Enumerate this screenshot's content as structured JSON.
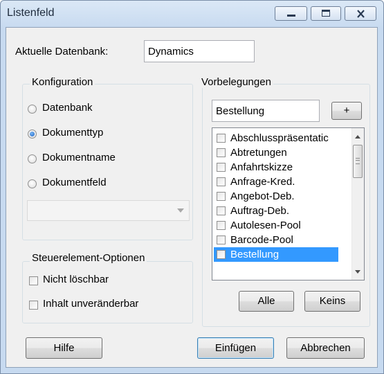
{
  "window": {
    "title": "Listenfeld"
  },
  "database": {
    "label": "Aktuelle Datenbank:",
    "value": "Dynamics"
  },
  "config": {
    "title": "Konfiguration",
    "options": [
      {
        "label": "Datenbank",
        "selected": false
      },
      {
        "label": "Dokumenttyp",
        "selected": true
      },
      {
        "label": "Dokumentname",
        "selected": false
      },
      {
        "label": "Dokumentfeld",
        "selected": false
      }
    ],
    "combo_value": ""
  },
  "control_options": {
    "title": "Steuerelement-Optionen",
    "items": [
      {
        "label": "Nicht löschbar",
        "checked": false
      },
      {
        "label": "Inhalt unveränderbar",
        "checked": false
      }
    ]
  },
  "presets": {
    "title": "Vorbelegungen",
    "input_value": "Bestellung",
    "add_label": "+",
    "items": [
      {
        "label": "Abschlusspräsentatic",
        "checked": false,
        "selected": false
      },
      {
        "label": "Abtretungen",
        "checked": false,
        "selected": false
      },
      {
        "label": "Anfahrtskizze",
        "checked": false,
        "selected": false
      },
      {
        "label": "Anfrage-Kred.",
        "checked": false,
        "selected": false
      },
      {
        "label": "Angebot-Deb.",
        "checked": false,
        "selected": false
      },
      {
        "label": "Auftrag-Deb.",
        "checked": false,
        "selected": false
      },
      {
        "label": "Autolesen-Pool",
        "checked": false,
        "selected": false
      },
      {
        "label": "Barcode-Pool",
        "checked": false,
        "selected": false
      },
      {
        "label": "Bestellung",
        "checked": false,
        "selected": true
      }
    ],
    "all_label": "Alle",
    "none_label": "Keins"
  },
  "footer": {
    "help_label": "Hilfe",
    "insert_label": "Einfügen",
    "cancel_label": "Abbrechen"
  },
  "colors": {
    "selection": "#3399ff",
    "default_button_border": "#3c7fb1"
  }
}
